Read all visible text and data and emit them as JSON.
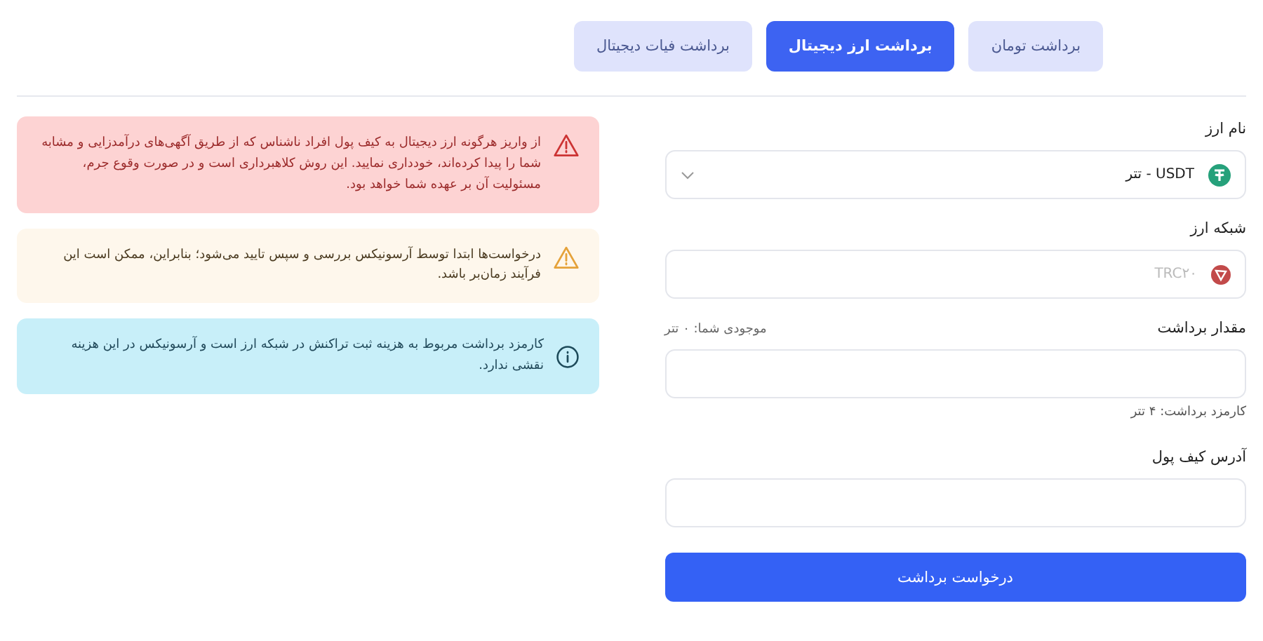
{
  "tabs": [
    {
      "label": "برداشت تومان",
      "selected": false
    },
    {
      "label": "برداشت ارز دیجیتال",
      "selected": true
    },
    {
      "label": "برداشت فیات دیجیتال",
      "selected": false
    }
  ],
  "form": {
    "currency": {
      "label": "نام ارز",
      "value": "USDT - تتر"
    },
    "network": {
      "label": "شبکه ارز",
      "value": "TRC۲۰",
      "disabled": true
    },
    "amount": {
      "label": "مقدار برداشت",
      "balance": "موجودی شما: ۰ تتر",
      "fee": "کارمزد برداشت: ۴ تتر"
    },
    "address": {
      "label": "آدرس کیف پول"
    },
    "submit": "درخواست برداشت"
  },
  "alerts": [
    {
      "kind": "danger",
      "text": "از واریز هرگونه ارز دیجیتال به کیف پول افراد ناشناس که از طریق آگهی‌های درآمدزایی و مشابه شما را پیدا کرده‌اند، خودداری نمایید. این روش کلاهبرداری است و در صورت وقوع جرم، مسئولیت آن بر عهده شما خواهد بود."
    },
    {
      "kind": "warning",
      "text": "درخواست‌ها ابتدا توسط آرسونیکس بررسی و سپس تایید می‌شود؛ بنابراین، ممکن است این فرآیند زمان‌بر باشد."
    },
    {
      "kind": "info",
      "text": "کارمزد برداشت مربوط به هزینه ثبت تراکنش در شبکه ارز است و آرسونیکس در این هزینه نقشی ندارد."
    }
  ]
}
